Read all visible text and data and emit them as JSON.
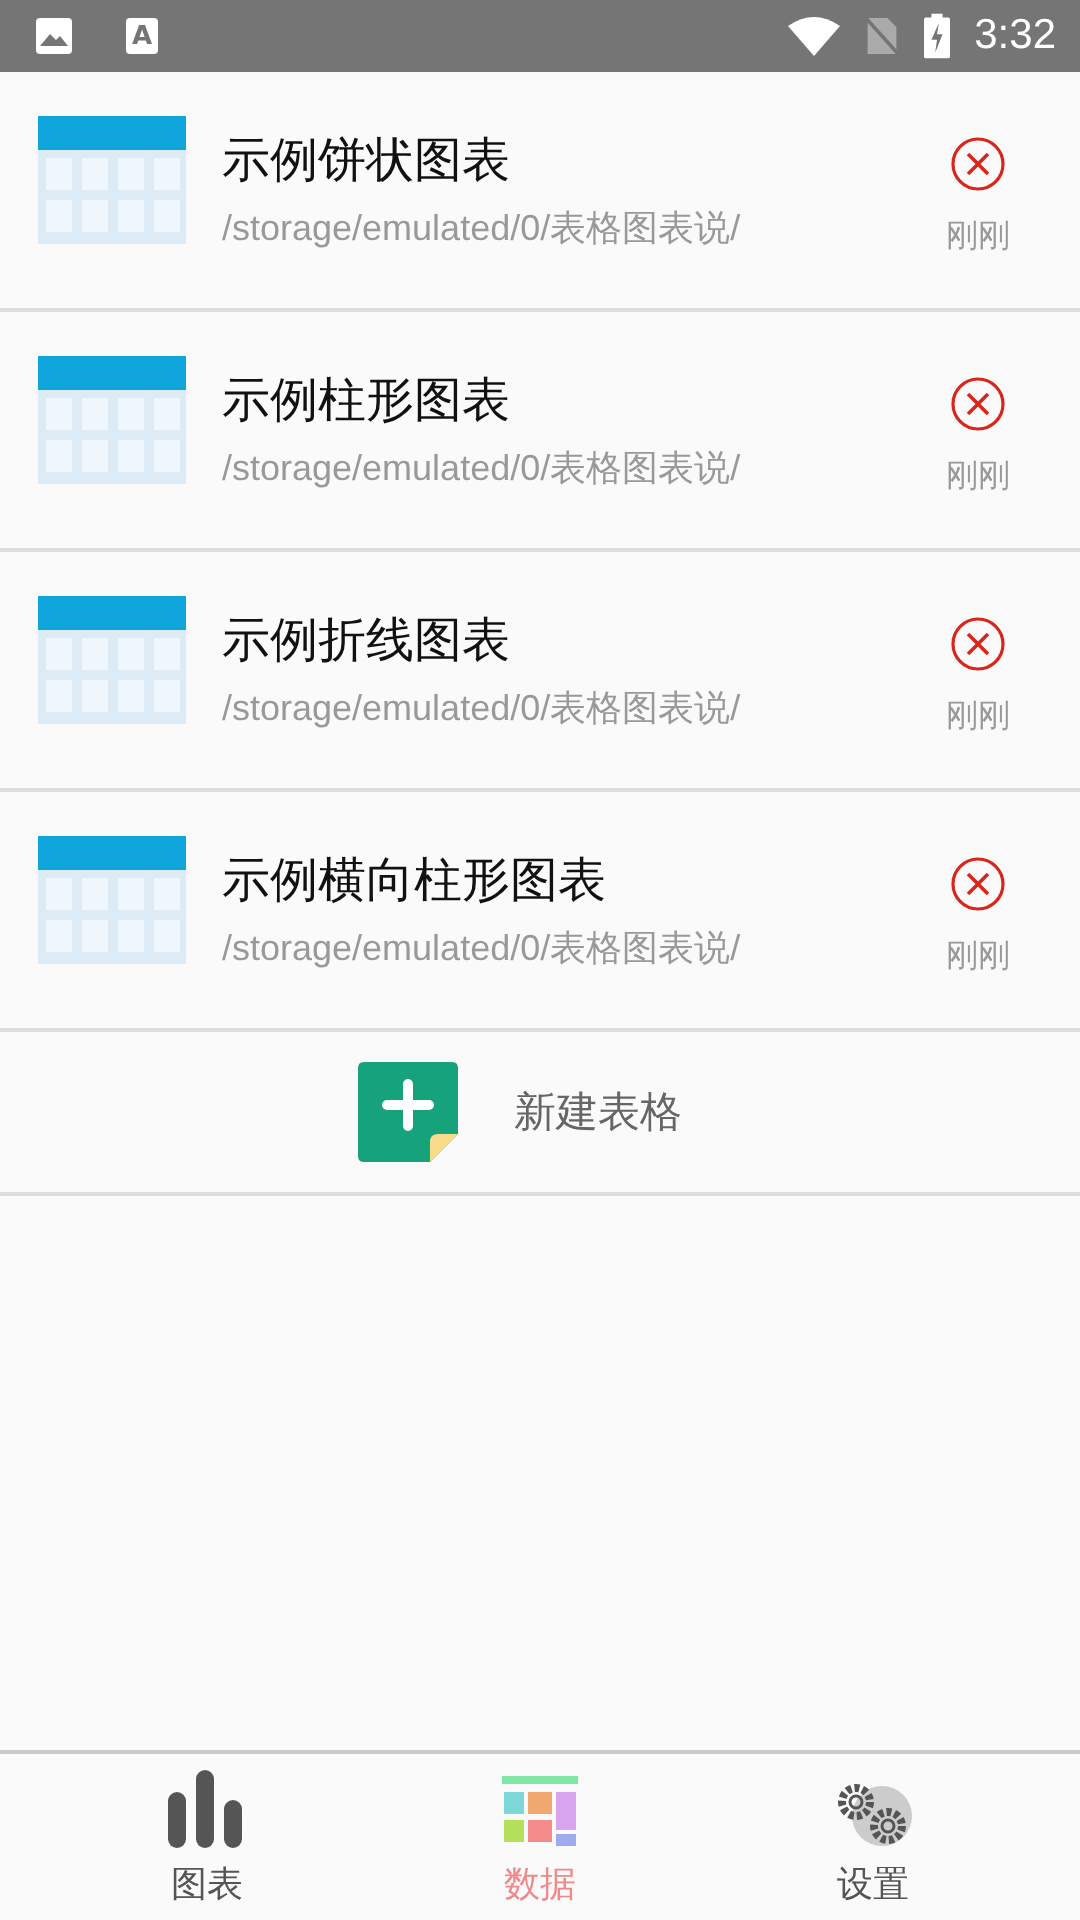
{
  "status_bar": {
    "time": "3:32",
    "notification_letter": "A"
  },
  "files": [
    {
      "name": "示例饼状图表",
      "path": "/storage/emulated/0/表格图表说/",
      "time": "刚刚"
    },
    {
      "name": "示例柱形图表",
      "path": "/storage/emulated/0/表格图表说/",
      "time": "刚刚"
    },
    {
      "name": "示例折线图表",
      "path": "/storage/emulated/0/表格图表说/",
      "time": "刚刚"
    },
    {
      "name": "示例横向柱形图表",
      "path": "/storage/emulated/0/表格图表说/",
      "time": "刚刚"
    }
  ],
  "new_table_button": {
    "label": "新建表格"
  },
  "bottom_nav": [
    {
      "kind": "chart",
      "label": "图表",
      "selected": false
    },
    {
      "kind": "data",
      "label": "数据",
      "selected": true
    },
    {
      "kind": "settings",
      "label": "设置",
      "selected": false
    }
  ]
}
